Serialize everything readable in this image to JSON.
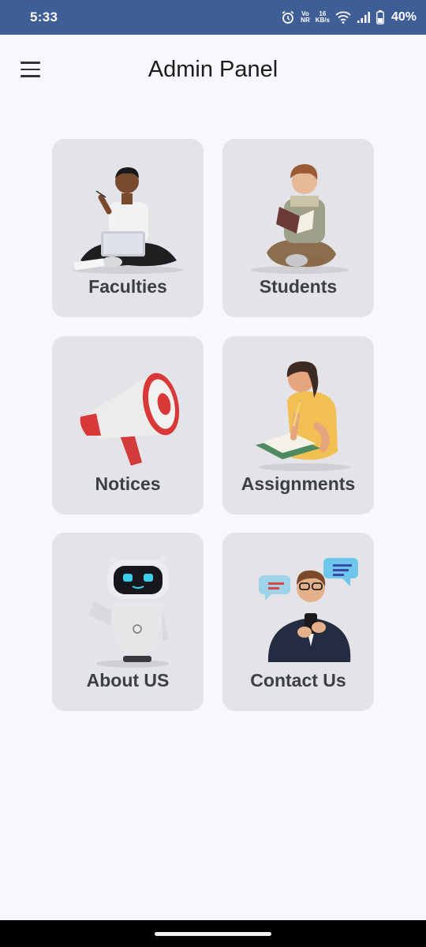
{
  "status_bar": {
    "time": "5:33",
    "network_top": "Vo",
    "network_bottom": "NR",
    "speed_value": "16",
    "speed_unit": "KB/s",
    "battery": "40%",
    "icons": [
      "alarm-icon",
      "volte-icon",
      "data-speed",
      "wifi-icon",
      "signal-icon",
      "battery-icon"
    ]
  },
  "app_bar": {
    "title": "Admin Panel",
    "menu_icon": "hamburger-menu-icon"
  },
  "cards": [
    {
      "label": "Faculties",
      "icon": "faculty-with-laptop-illustration"
    },
    {
      "label": "Students",
      "icon": "student-reading-illustration"
    },
    {
      "label": "Notices",
      "icon": "megaphone-illustration"
    },
    {
      "label": "Assignments",
      "icon": "person-writing-illustration"
    },
    {
      "label": "About US",
      "icon": "robot-illustration"
    },
    {
      "label": "Contact Us",
      "icon": "man-with-phone-chat-illustration"
    }
  ],
  "colors": {
    "status_bar": "#3f5e95",
    "background": "#f7f7fc",
    "card": "#e3e3e8",
    "card_text": "#3b3f46"
  }
}
